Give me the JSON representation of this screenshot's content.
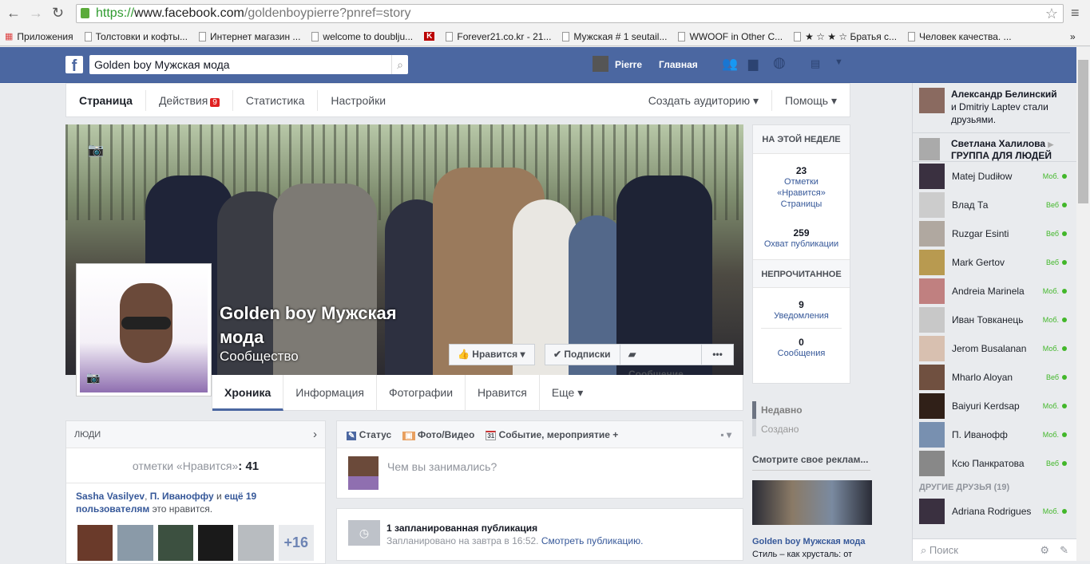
{
  "browser": {
    "url_secure": "https://",
    "url_domain": "www.facebook.com",
    "url_path": "/goldenboypierre?pnref=story",
    "bookmarks": [
      "Приложения",
      "Толстовки и кофты...",
      "Интернет магазин ...",
      "welcome to doublju...",
      "Forever21.co.kr - 21...",
      "Мужская # 1 seutail...",
      "WWOOF in Other C...",
      "★ ☆ ★ ☆ Братья с...",
      "Человек качества. ..."
    ],
    "more": "»"
  },
  "topbar": {
    "search_value": "Golden boy  Мужская мода",
    "user": "Pierre",
    "home": "Главная"
  },
  "page_tabs": {
    "items": [
      "Страница",
      "Действия",
      "Статистика",
      "Настройки"
    ],
    "actions_badge": "9",
    "create_audience": "Создать аудиторию ▾",
    "help": "Помощь ▾"
  },
  "cover": {
    "name": "Golden boy Мужская мода",
    "category": "Сообщество",
    "like": "Нравится",
    "subscriptions": "Подписки",
    "message": "Сообщение",
    "more": "•••"
  },
  "nav_tabs": [
    "Хроника",
    "Информация",
    "Фотографии",
    "Нравится",
    "Еще ▾"
  ],
  "week": {
    "title": "НА ЭТОЙ НЕДЕЛЕ",
    "likes": "23",
    "likes_label": "Отметки «Нравится» Страницы",
    "reach": "259",
    "reach_label": "Охват публикации",
    "unread_title": "НЕПРОЧИТАННОЕ",
    "notifications": "9",
    "notifications_label": "Уведомления",
    "messages": "0",
    "messages_label": "Сообщения"
  },
  "people": {
    "title": "ЛЮДИ",
    "likes_label": "отметки «Нравится»",
    "likes_count": ": 41",
    "friends_text_a": "Sasha Vasilyev",
    "friends_text_b": ", ",
    "friends_text_c": "П. Иванoффу",
    "friends_text_d": " и ",
    "friends_text_e": "ещё 19 пользователям",
    "friends_text_f": " это нравится.",
    "more": "+16"
  },
  "composer": {
    "status": "Статус",
    "photo": "Фото/Видео",
    "event": "Событие, мероприятие +",
    "placeholder": "Чем вы занимались?"
  },
  "scheduled": {
    "title": "1 запланированная публикация",
    "sub": "Запланировано на завтра в 16:52. ",
    "link": "Смотреть публикацию."
  },
  "filter": {
    "recent": "Недавно",
    "created": "Создано"
  },
  "ad": {
    "title": "Смотрите свое реклам...",
    "page": "Golden boy Мужская мода",
    "text": "Стиль – как хрусталь: от"
  },
  "ticker": {
    "a_name": "Александр Белинский",
    "a_mid": " и ",
    "a_name2": "Dmitriy Laptev",
    "a_rest": " стали друзьями.",
    "b_name": "Светлана Халилова",
    "b_rest": "ГРУППА ДЛЯ ЛЮДЕЙ"
  },
  "chat": {
    "friends": [
      {
        "name": "Matej Dudiłow",
        "status": "Моб."
      },
      {
        "name": "Влад Та",
        "status": "Веб"
      },
      {
        "name": "Ruzgar Esinti",
        "status": "Веб"
      },
      {
        "name": "Mark Gertov",
        "status": "Веб"
      },
      {
        "name": "Andreia Marinela",
        "status": "Моб."
      },
      {
        "name": "Иван Товканець",
        "status": "Моб."
      },
      {
        "name": "Jerom Busalanan",
        "status": "Моб."
      },
      {
        "name": "Mharlo Aloyan",
        "status": "Веб"
      },
      {
        "name": "Baiyuri Kerdsap",
        "status": "Моб."
      },
      {
        "name": "П. Иванофф",
        "status": "Моб."
      },
      {
        "name": "Ксю Панкратова",
        "status": "Веб"
      }
    ],
    "other_title": "ДРУГИЕ ДРУЗЬЯ (19)",
    "other": [
      {
        "name": "Adriana Rodrigues",
        "status": "Моб."
      }
    ],
    "search_placeholder": "Поиск"
  }
}
